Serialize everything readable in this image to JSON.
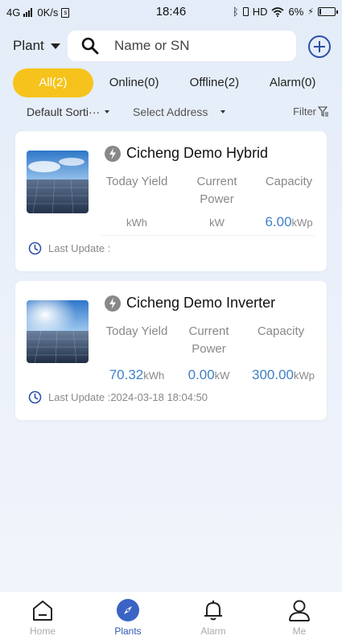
{
  "status_bar": {
    "network": "4G",
    "speed": "0K/s",
    "time": "18:46",
    "hd": "HD",
    "battery": "6%"
  },
  "topbar": {
    "plant_label": "Plant",
    "search_placeholder": "Name or SN"
  },
  "tabs": [
    {
      "label": "All(2)",
      "active": true
    },
    {
      "label": "Online(0)",
      "active": false
    },
    {
      "label": "Offline(2)",
      "active": false
    },
    {
      "label": "Alarm(0)",
      "active": false
    }
  ],
  "sort": {
    "default_label": "Default Sorti···",
    "address_label": "Select Address",
    "filter_label": "Filter"
  },
  "plants": [
    {
      "name": "Cicheng Demo Hybrid",
      "headers": [
        "Today Yield",
        "Current Power",
        "Capacity"
      ],
      "today_yield": "",
      "today_yield_unit": "kWh",
      "current_power": "",
      "current_power_unit": "kW",
      "capacity": "6.00",
      "capacity_unit": "kWp",
      "last_update_label": "Last Update :",
      "last_update_value": ""
    },
    {
      "name": "Cicheng Demo Inverter",
      "headers": [
        "Today Yield",
        "Current Power",
        "Capacity"
      ],
      "today_yield": "70.32",
      "today_yield_unit": "kWh",
      "current_power": "0.00",
      "current_power_unit": "kW",
      "capacity": "300.00",
      "capacity_unit": "kWp",
      "last_update_label": "Last Update :",
      "last_update_value": "2024-03-18 18:04:50"
    }
  ],
  "bottom_nav": [
    {
      "label": "Home",
      "icon": "home-icon",
      "active": false
    },
    {
      "label": "Plants",
      "icon": "compass-icon",
      "active": true
    },
    {
      "label": "Alarm",
      "icon": "bell-icon",
      "active": false
    },
    {
      "label": "Me",
      "icon": "user-icon",
      "active": false
    }
  ],
  "colors": {
    "accent_yellow": "#f6c31c",
    "primary_blue": "#2c4fa8",
    "value_blue": "#3f7fc6"
  }
}
